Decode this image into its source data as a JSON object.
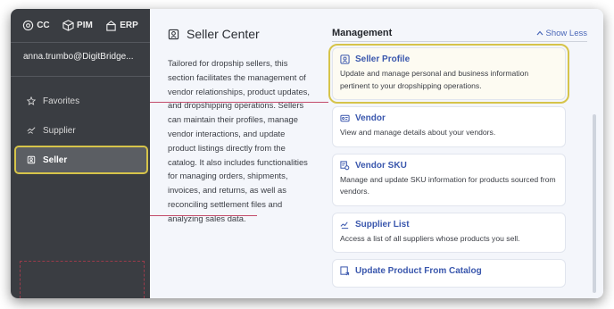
{
  "apps": [
    {
      "label": "CC",
      "icon": "cc-app-icon"
    },
    {
      "label": "PIM",
      "icon": "pim-app-icon"
    },
    {
      "label": "ERP",
      "icon": "erp-app-icon"
    }
  ],
  "user": {
    "email": "anna.trumbo@DigitBridge..."
  },
  "nav": [
    {
      "label": "Favorites",
      "icon": "star-icon"
    },
    {
      "label": "Supplier",
      "icon": "supplier-icon"
    },
    {
      "label": "Seller",
      "icon": "seller-icon"
    }
  ],
  "section": {
    "title": "Seller Center",
    "description": "Tailored for dropship sellers, this section facilitates the management of vendor relationships, product updates, and dropshipping operations. Sellers can maintain their profiles, manage vendor interactions, and update product listings directly from the catalog. It also includes functionalities for managing orders, shipments, invoices, and returns, as well as reconciling settlement files and analyzing sales data."
  },
  "management": {
    "title": "Management",
    "toggle": "Show Less",
    "cards": [
      {
        "title": "Seller Profile",
        "desc": "Update and manage personal and business information pertinent to your dropshipping operations."
      },
      {
        "title": "Vendor",
        "desc": "View and manage details about your vendors."
      },
      {
        "title": "Vendor SKU",
        "desc": "Manage and update SKU information for products sourced from vendors."
      },
      {
        "title": "Supplier List",
        "desc": "Access a list of all suppliers whose products you sell."
      },
      {
        "title": "Update Product From Catalog",
        "desc": ""
      }
    ]
  },
  "colors": {
    "highlight": "#d6c44a",
    "accent": "#3a57ad",
    "sidebar": "#3a3d42"
  }
}
